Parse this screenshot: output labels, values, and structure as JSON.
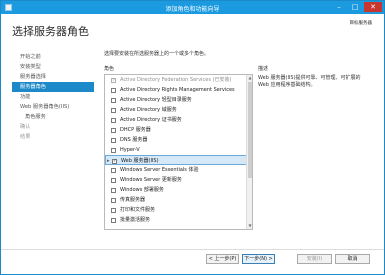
{
  "window": {
    "title": "添加角色和功能向导"
  },
  "heading": "选择服务器角色",
  "destination": {
    "label": "目标服务器",
    "host": ""
  },
  "nav": [
    {
      "label": "开始之前",
      "state": "normal"
    },
    {
      "label": "安装类型",
      "state": "normal"
    },
    {
      "label": "服务器选择",
      "state": "normal"
    },
    {
      "label": "服务器角色",
      "state": "active"
    },
    {
      "label": "功能",
      "state": "normal"
    },
    {
      "label": "Web 服务器角色(IIS)",
      "state": "normal"
    },
    {
      "label": "角色服务",
      "state": "sub"
    },
    {
      "label": "确认",
      "state": "dim"
    },
    {
      "label": "结果",
      "state": "dim"
    }
  ],
  "instruction": "选择要安装在所选服务器上的一个或多个角色。",
  "roles_label": "角色",
  "description_label": "描述",
  "roles": [
    {
      "label": "Active Directory Federation Services (已安装)",
      "checked": true,
      "dim": true,
      "expandable": false,
      "selected": false
    },
    {
      "label": "Active Directory Rights Management Services",
      "checked": false,
      "dim": false,
      "expandable": false,
      "selected": false
    },
    {
      "label": "Active Directory 轻型目录服务",
      "checked": false,
      "dim": false,
      "expandable": false,
      "selected": false
    },
    {
      "label": "Active Directory 域服务",
      "checked": false,
      "dim": false,
      "expandable": false,
      "selected": false
    },
    {
      "label": "Active Directory 证书服务",
      "checked": false,
      "dim": false,
      "expandable": false,
      "selected": false
    },
    {
      "label": "DHCP 服务器",
      "checked": false,
      "dim": false,
      "expandable": false,
      "selected": false
    },
    {
      "label": "DNS 服务器",
      "checked": false,
      "dim": false,
      "expandable": false,
      "selected": false
    },
    {
      "label": "Hyper-V",
      "checked": false,
      "dim": false,
      "expandable": false,
      "selected": false
    },
    {
      "label": "Web 服务器(IIS)",
      "checked": true,
      "dim": false,
      "expandable": true,
      "selected": true
    },
    {
      "label": "Windows Server Essentials 体验",
      "checked": false,
      "dim": false,
      "expandable": false,
      "selected": false
    },
    {
      "label": "Windows Server 更新服务",
      "checked": false,
      "dim": false,
      "expandable": false,
      "selected": false
    },
    {
      "label": "Windows 部署服务",
      "checked": false,
      "dim": false,
      "expandable": false,
      "selected": false
    },
    {
      "label": "传真服务器",
      "checked": false,
      "dim": false,
      "expandable": false,
      "selected": false
    },
    {
      "label": "打印和文件服务",
      "checked": false,
      "dim": false,
      "expandable": false,
      "selected": false
    },
    {
      "label": "批量激活服务",
      "checked": false,
      "dim": false,
      "expandable": false,
      "selected": false
    }
  ],
  "description": "Web 服务器(IIS)提供可靠、可管理、可扩展的 Web 应用程序基础结构。",
  "buttons": {
    "prev": "< 上一步(P)",
    "next": "下一步(N) >",
    "install": "安装(I)",
    "cancel": "取消"
  }
}
